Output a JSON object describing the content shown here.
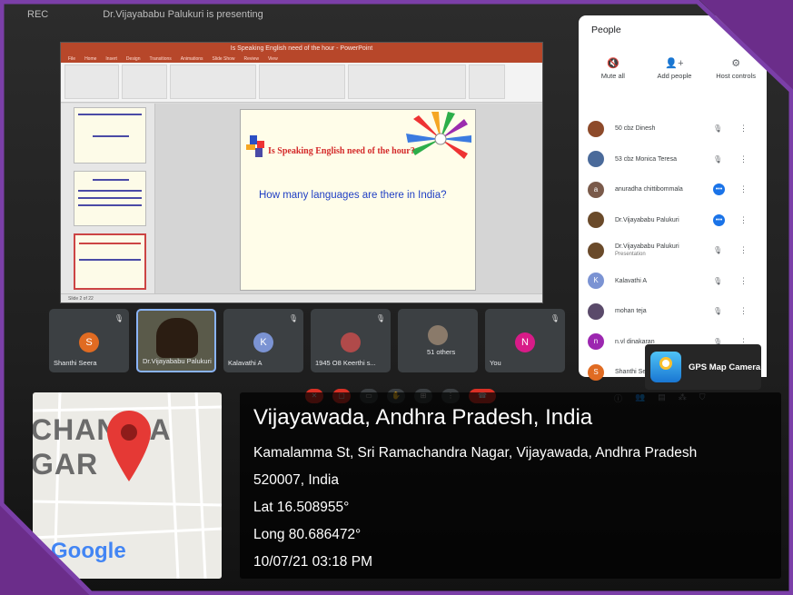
{
  "meet": {
    "presenting_banner": "Dr.Vijayababu Palukuri is presenting",
    "left_label": "REC"
  },
  "ppt": {
    "title_bar": "Is Speaking English need of the hour - PowerPoint",
    "tabs": [
      "File",
      "Home",
      "Insert",
      "Design",
      "Transitions",
      "Animations",
      "Slide Show",
      "Review",
      "View"
    ],
    "status": "Slide 2 of 22",
    "slide": {
      "title": "Is Speaking English need of the hour?",
      "body": "How many languages are there in India?"
    }
  },
  "tiles": [
    {
      "name": "Shanthi Seera",
      "initial": "S",
      "color": "#e06b22",
      "type": "avatar"
    },
    {
      "name": "Dr.Vijayababu Palukuri",
      "type": "video",
      "active": true
    },
    {
      "name": "Kalavathi A",
      "initial": "K",
      "color": "#7b93d3",
      "type": "avatar"
    },
    {
      "name": "1945 O8 Keerthi s...",
      "type": "photo"
    },
    {
      "name": "51 others",
      "type": "group"
    },
    {
      "name": "You",
      "initial": "N",
      "color": "#d81b88",
      "type": "avatar"
    }
  ],
  "people": {
    "title": "People",
    "actions": [
      {
        "label": "Mute all",
        "icon": "mic-off-icon"
      },
      {
        "label": "Add people",
        "icon": "add-person-icon"
      },
      {
        "label": "Host controls",
        "icon": "host-controls-icon"
      }
    ],
    "list": [
      {
        "name": "50 cbz Dinesh",
        "sub": "",
        "initial": "",
        "color": "#8d4a2a",
        "mic": "muted"
      },
      {
        "name": "53 cbz Monica Teresa",
        "sub": "",
        "initial": "",
        "color": "#4a6a9a",
        "mic": "muted"
      },
      {
        "name": "anuradha chittibommala",
        "sub": "",
        "initial": "a",
        "color": "#7a5a4a",
        "mic": "speaking"
      },
      {
        "name": "Dr.Vijayababu Palukuri",
        "sub": "",
        "initial": "",
        "color": "#6a4a2a",
        "mic": "speaking"
      },
      {
        "name": "Dr.Vijayababu Palukuri",
        "sub": "Presentation",
        "initial": "",
        "color": "#6a4a2a",
        "mic": "muted"
      },
      {
        "name": "Kalavathi A",
        "sub": "",
        "initial": "K",
        "color": "#7b93d3",
        "mic": "muted"
      },
      {
        "name": "mohan teja",
        "sub": "",
        "initial": "",
        "color": "#5a4a6a",
        "mic": "muted"
      },
      {
        "name": "n.vl dinakaran",
        "sub": "",
        "initial": "n",
        "color": "#9c27b0",
        "mic": "muted"
      },
      {
        "name": "Shanthi Seera",
        "sub": "",
        "initial": "S",
        "color": "#e06b22",
        "mic": "muted"
      }
    ]
  },
  "gps": {
    "app_name": "GPS Map Camera",
    "map_text": "CHAN RA\nGAR",
    "google": "Google",
    "title": "Vijayawada, Andhra Pradesh, India",
    "address": "Kamalamma St, Sri Ramachandra Nagar, Vijayawada, Andhra Pradesh 520007, India",
    "lat": "Lat 16.508955°",
    "long": "Long 80.686472°",
    "datetime": "10/07/21 03:18 PM"
  }
}
